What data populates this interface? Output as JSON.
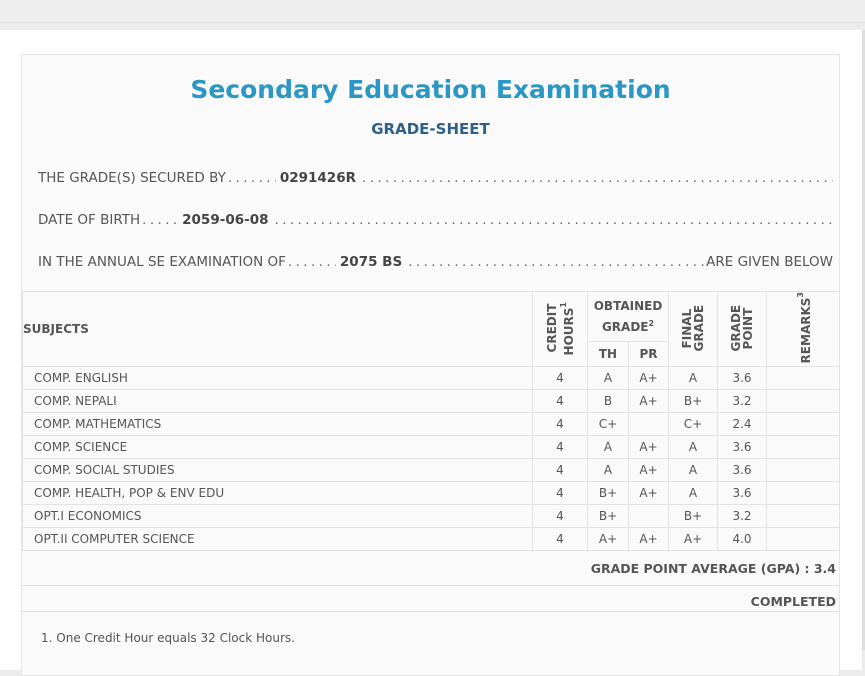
{
  "title": "Secondary Education Examination",
  "subtitle": "GRADE-SHEET",
  "lines": {
    "secured_label": "THE GRADE(S) SECURED BY",
    "symbol_no": "0291426R",
    "dob_label": "DATE OF BIRTH",
    "dob": "2059-06-08",
    "exam_label": "IN THE ANNUAL SE EXAMINATION OF",
    "exam_year": "2075 BS",
    "exam_suffix": "ARE GIVEN BELOW"
  },
  "table": {
    "headers": {
      "subjects": "SUBJECTS",
      "credit_hours": "CREDIT HOURS",
      "credit_sup": "1",
      "obtained_grade": "OBTAINED GRADE",
      "obtained_sup": "2",
      "th": "TH",
      "pr": "PR",
      "final_grade": "FINAL GRADE",
      "grade_point": "GRADE POINT",
      "remarks": "REMARKS",
      "remarks_sup": "3"
    },
    "rows": [
      {
        "subject": "COMP. ENGLISH",
        "credit": "4",
        "th": "A",
        "pr": "A+",
        "final": "A",
        "gp": "3.6",
        "remarks": ""
      },
      {
        "subject": "COMP. NEPALI",
        "credit": "4",
        "th": "B",
        "pr": "A+",
        "final": "B+",
        "gp": "3.2",
        "remarks": ""
      },
      {
        "subject": "COMP. MATHEMATICS",
        "credit": "4",
        "th": "C+",
        "pr": "",
        "final": "C+",
        "gp": "2.4",
        "remarks": ""
      },
      {
        "subject": "COMP. SCIENCE",
        "credit": "4",
        "th": "A",
        "pr": "A+",
        "final": "A",
        "gp": "3.6",
        "remarks": ""
      },
      {
        "subject": "COMP. SOCIAL STUDIES",
        "credit": "4",
        "th": "A",
        "pr": "A+",
        "final": "A",
        "gp": "3.6",
        "remarks": ""
      },
      {
        "subject": "COMP. HEALTH, POP & ENV EDU",
        "credit": "4",
        "th": "B+",
        "pr": "A+",
        "final": "A",
        "gp": "3.6",
        "remarks": ""
      },
      {
        "subject": "OPT.I ECONOMICS",
        "credit": "4",
        "th": "B+",
        "pr": "",
        "final": "B+",
        "gp": "3.2",
        "remarks": ""
      },
      {
        "subject": "OPT.II COMPUTER SCIENCE",
        "credit": "4",
        "th": "A+",
        "pr": "A+",
        "final": "A+",
        "gp": "4.0",
        "remarks": ""
      }
    ]
  },
  "gpa_text": "GRADE POINT AVERAGE (GPA) : 3.4",
  "status": "COMPLETED",
  "footnote": "1. One Credit Hour equals 32 Clock Hours.",
  "colors": {
    "title": "#2a97c4",
    "subtitle": "#2e5f8a"
  }
}
